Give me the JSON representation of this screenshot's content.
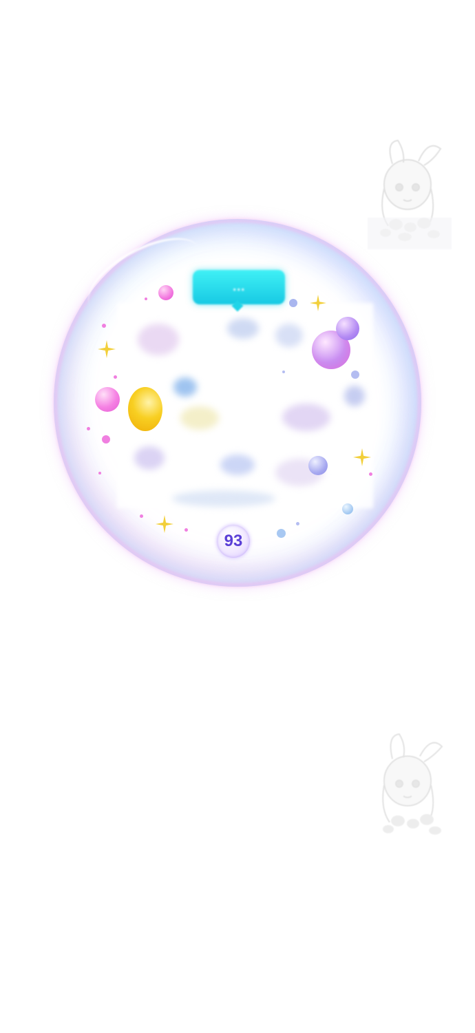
{
  "panel": {
    "title_label": "…",
    "page_number": "93"
  },
  "colors": {
    "bubble_rim_pink": "#f5b4f0",
    "bubble_rim_cyan": "#aae6fa",
    "title_pill": "#1fd6ea",
    "badge_text": "#5a3fd6",
    "sparkle": "#f2cf3a"
  },
  "decorations": {
    "sparkle_icon": "sparkle-star",
    "bubble_icon": "soap-bubble",
    "mascot_icon": "chibi-character-watermark"
  }
}
